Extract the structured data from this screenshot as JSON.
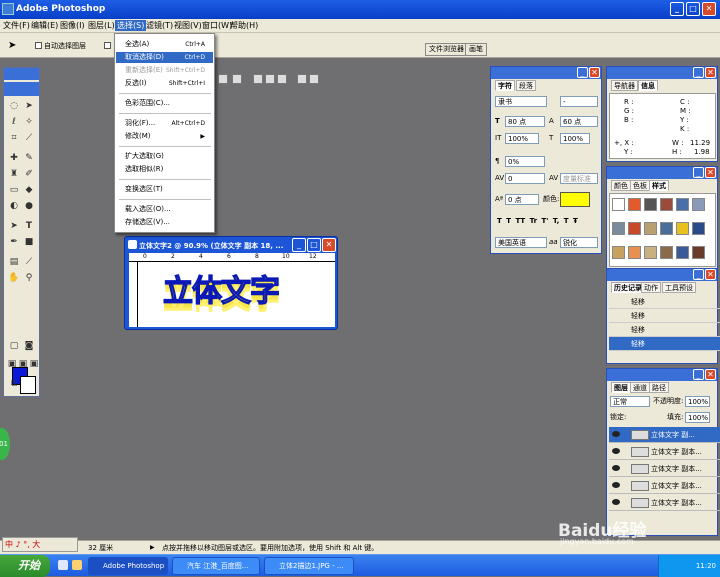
{
  "app": {
    "title": "Adobe Photoshop"
  },
  "menu": {
    "items": [
      "文件(F)",
      "编辑(E)",
      "图像(I)",
      "图层(L)",
      "选择(S)",
      "滤镜(T)",
      "视图(V)",
      "窗口(W)",
      "帮助(H)"
    ]
  },
  "options": {
    "auto_select": "自动选择图层"
  },
  "top_tabs": [
    "文件浏览器",
    "画笔"
  ],
  "select_menu": [
    {
      "label": "全选(A)",
      "shortcut": "Ctrl+A",
      "state": "normal"
    },
    {
      "label": "取消选择(D)",
      "shortcut": "Ctrl+D",
      "state": "selected"
    },
    {
      "label": "重新选择(E)",
      "shortcut": "Shift+Ctrl+D",
      "state": "disabled"
    },
    {
      "label": "反选(I)",
      "shortcut": "Shift+Ctrl+I",
      "state": "normal"
    },
    {
      "label": "色彩范围(C)...",
      "shortcut": "",
      "state": "normal"
    },
    {
      "label": "羽化(F)...",
      "shortcut": "Alt+Ctrl+D",
      "state": "normal"
    },
    {
      "label": "修改(M)",
      "shortcut": "▶",
      "state": "normal"
    },
    {
      "label": "扩大选取(G)",
      "shortcut": "",
      "state": "normal"
    },
    {
      "label": "选取相似(R)",
      "shortcut": "",
      "state": "normal"
    },
    {
      "label": "变换选区(T)",
      "shortcut": "",
      "state": "normal"
    },
    {
      "label": "载入选区(O)...",
      "shortcut": "",
      "state": "normal"
    },
    {
      "label": "存储选区(V)...",
      "shortcut": "",
      "state": "normal"
    }
  ],
  "document": {
    "title": "立体文字2 @ 90.9% (立体文字 副本 18, ...",
    "artwork_text": "立体文字",
    "ruler_marks": [
      "0",
      "2",
      "4",
      "6",
      "8",
      "10",
      "12"
    ]
  },
  "character_panel": {
    "tabs": [
      "字符",
      "段落"
    ],
    "font": "隶书",
    "style": "-",
    "size": "80 点",
    "leading": "60 点",
    "vscale": "100%",
    "hscale": "100%",
    "tracking_pct": "0%",
    "kerning": "0",
    "kerning_metric": "度量标准",
    "baseline": "0 点",
    "color_label": "颜色:",
    "color": "#ffff00",
    "style_buttons": [
      "T",
      "T",
      "TT",
      "Tr",
      "T'",
      "T,",
      "T",
      "Ŧ"
    ],
    "language": "美国英语",
    "aa_icon": "aa",
    "antialias": "锐化"
  },
  "info_panel": {
    "tabs": [
      "导航器",
      "信息"
    ],
    "left_labels": [
      "R :",
      "G :",
      "B :",
      "+, X :",
      "Y :"
    ],
    "right_labels": [
      "C :",
      "M :",
      "Y :",
      "K :"
    ],
    "w_label": "W :",
    "w": "11.29",
    "h_label": "H :",
    "h": "1.98"
  },
  "styles_panel": {
    "tabs": [
      "颜色",
      "色板",
      "样式"
    ]
  },
  "history_panel": {
    "tabs": [
      "历史记录",
      "动作",
      "工具预设"
    ],
    "items": [
      {
        "label": "轻移",
        "selected": false
      },
      {
        "label": "轻移",
        "selected": false
      },
      {
        "label": "轻移",
        "selected": false
      },
      {
        "label": "轻移",
        "selected": true
      }
    ]
  },
  "layers_panel": {
    "tabs": [
      "图层",
      "通道",
      "路径"
    ],
    "mode": "正常",
    "opacity_label": "不透明度:",
    "opacity": "100%",
    "lock_label": "锁定:",
    "fill_label": "填充:",
    "fill": "100%",
    "layers": [
      {
        "name": "立体文字 副...",
        "selected": true
      },
      {
        "name": "立体文字 副本...",
        "selected": false
      },
      {
        "name": "立体文字 副本...",
        "selected": false
      },
      {
        "name": "立体文字 副本...",
        "selected": false
      },
      {
        "name": "立体文字 副本...",
        "selected": false
      }
    ]
  },
  "status": {
    "zoom": "32 厘米",
    "message": "点按并拖移以移动图层或选区。要用附加选项，使用 Shift 和 Alt 键。"
  },
  "ime": "中 ♪ °, 大",
  "taskbar": {
    "start": "开始",
    "tasks": [
      "Adobe Photoshop",
      "汽车 江港_百度图...",
      "立体2描边1.JPG - ..."
    ],
    "time": "11:20"
  },
  "watermark": {
    "brand": "Baidu经验",
    "url": "jingyan.baidu.com"
  }
}
